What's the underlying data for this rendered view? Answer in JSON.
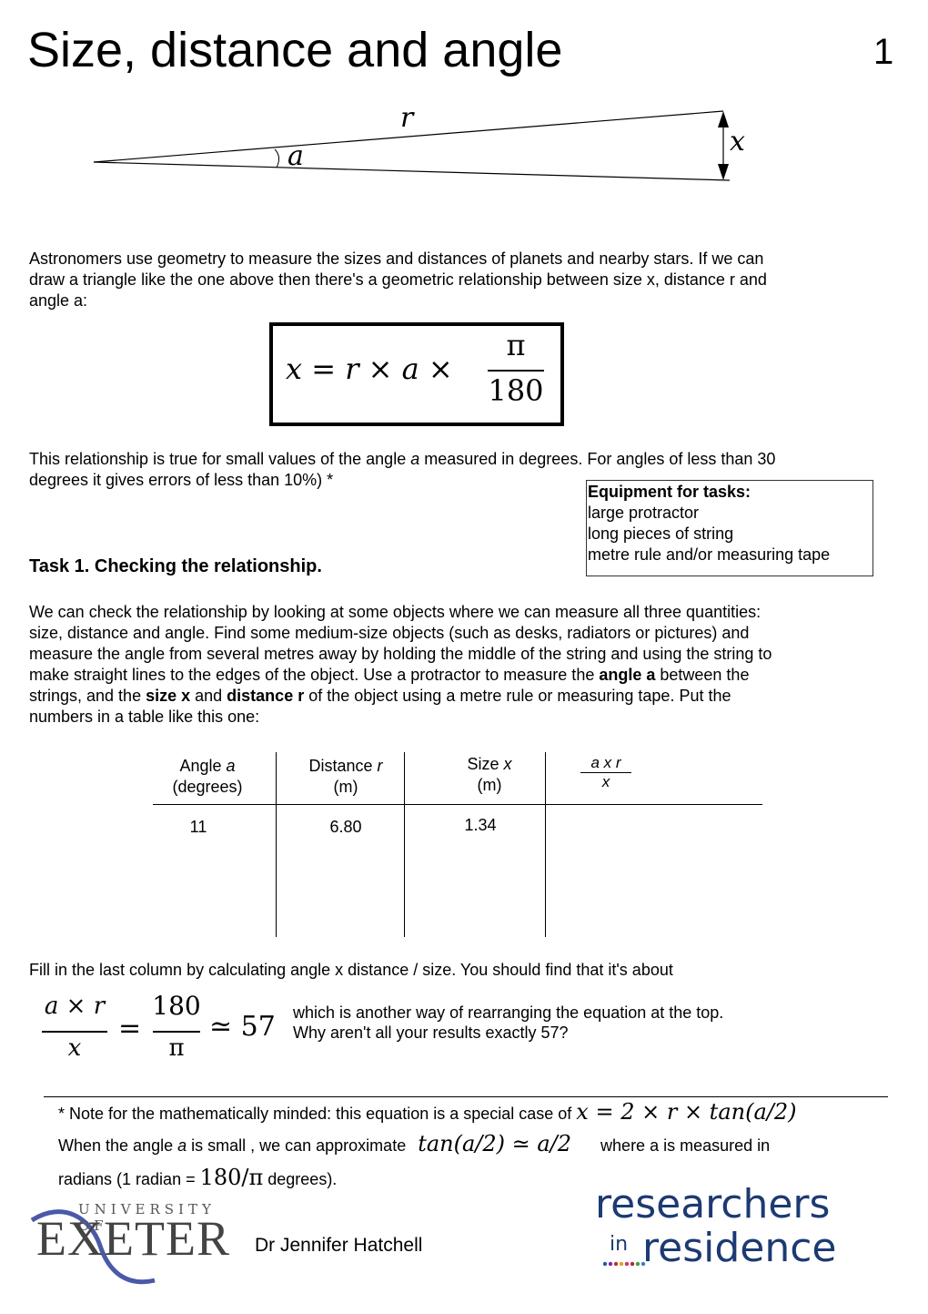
{
  "header": {
    "title": "Size, distance and angle",
    "page_number": "1"
  },
  "diagram": {
    "label_r": "r",
    "label_a": "a",
    "label_x": "x"
  },
  "intro": {
    "line1": "Astronomers use geometry to measure the sizes and distances of planets and nearby stars.  If we can",
    "line2": "draw a triangle like the one above then there's a geometric relationship between size x, distance r and",
    "line3": "angle a:"
  },
  "formula_main": {
    "lhs": "x = r × a ×",
    "numerator": "π",
    "denominator": "180"
  },
  "validity": {
    "line1_a": "This relationship is true for small values of the angle ",
    "line1_var": "a",
    "line1_b": " measured in degrees.  For angles of less than 30",
    "line2": "degrees it gives errors of less than 10%) *"
  },
  "equipment": {
    "heading": "Equipment for tasks:",
    "items": [
      "large protractor",
      "long pieces of string",
      "metre rule and/or measuring tape"
    ]
  },
  "task1": {
    "heading": "Task 1. Checking the relationship.",
    "lines": [
      "We can check the relationship by looking at some objects where we can measure all three quantities:",
      "size, distance and angle.   Find some medium-size objects (such as desks, radiators or pictures) and",
      "measure the angle from several metres away by holding the middle of the string and using the string to"
    ],
    "line4_a": "make straight lines to the edges of the object.  Use a protractor to measure the ",
    "line4_bold": "angle a",
    "line4_b": " between the",
    "line5_a": "strings, and the ",
    "line5_bold1": "size x",
    "line5_b": " and ",
    "line5_bold2": "distance r",
    "line5_c": " of the object using a metre rule or measuring tape.  Put the",
    "line6": "numbers in a table like this one:"
  },
  "table": {
    "headers": [
      {
        "label": "Angle ",
        "var": "a",
        "unit": "(degrees)"
      },
      {
        "label": "Distance ",
        "var": "r",
        "unit": "(m)"
      },
      {
        "label": "Size ",
        "var": "x",
        "unit": "(m)"
      },
      {
        "numerator": "a x r",
        "denominator": "x"
      }
    ],
    "rows": [
      [
        "11",
        "6.80",
        "1.34",
        ""
      ]
    ]
  },
  "fill_in": {
    "text": "Fill in the last column by calculating angle x distance / size.  You should find that it's about",
    "eq_num1": "a × r",
    "eq_den1": "x",
    "eq_num2": "180",
    "eq_den2": "π",
    "eq_tail": "≃ 57",
    "comment1": "which is another way of rearranging the equation at the top.",
    "comment2": "Why aren't all your results exactly 57?"
  },
  "note": {
    "line1_text": "* Note for the mathematically minded: this equation is a special case of ",
    "line1_math": "x = 2 × r × tan(a/2)",
    "line2_a": "When the angle ",
    "line2_var": "a",
    "line2_b": " is small , we can approximate ",
    "line2_math": "tan(a/2) ≃ a/2",
    "line2_c": "where a is measured in",
    "line3_a": "radians (1 radian = ",
    "line3_math": "180/π",
    "line3_b": " degrees)."
  },
  "footer": {
    "university_small": "UNIVERSITY OF",
    "university_big": "EXETER",
    "author": "Dr Jennifer Hatchell",
    "logo_line1": "researchers",
    "logo_in": "in",
    "logo_line2": "residence",
    "logo_colors": [
      "#1c3a73",
      "#5a8fd0",
      "#e8a33c"
    ]
  }
}
